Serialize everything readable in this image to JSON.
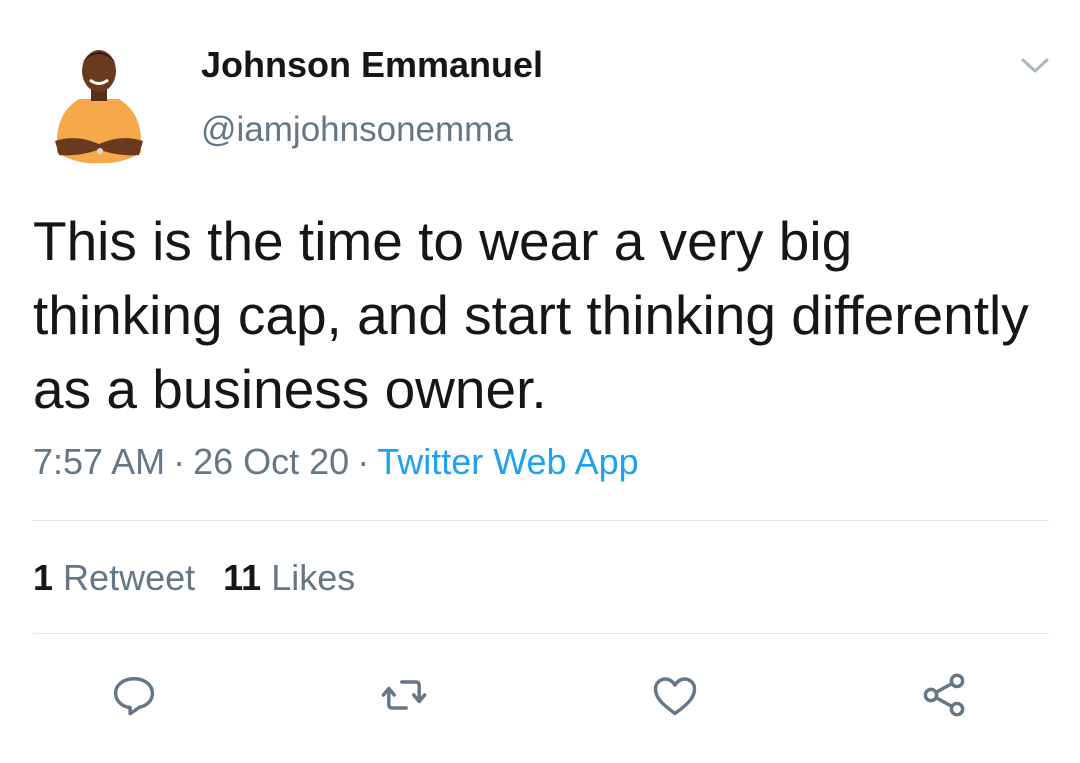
{
  "author": {
    "name": "Johnson Emmanuel",
    "handle": "@iamjohnsonemma"
  },
  "tweet": {
    "text": "This is the time to wear a very big thinking cap, and start thinking differently as a business owner."
  },
  "meta": {
    "time": "7:57 AM",
    "separator": "·",
    "date": "26 Oct 20",
    "source": "Twitter Web App"
  },
  "stats": {
    "retweets_count": "1",
    "retweets_label": "Retweet",
    "likes_count": "11",
    "likes_label": "Likes"
  },
  "actions": {
    "reply_icon": "reply-icon",
    "retweet_icon": "retweet-icon",
    "like_icon": "heart-icon",
    "share_icon": "share-icon"
  },
  "colors": {
    "text": "#14171a",
    "secondary": "#657786",
    "link": "#1da1f2",
    "divider": "#e1e8ed"
  }
}
